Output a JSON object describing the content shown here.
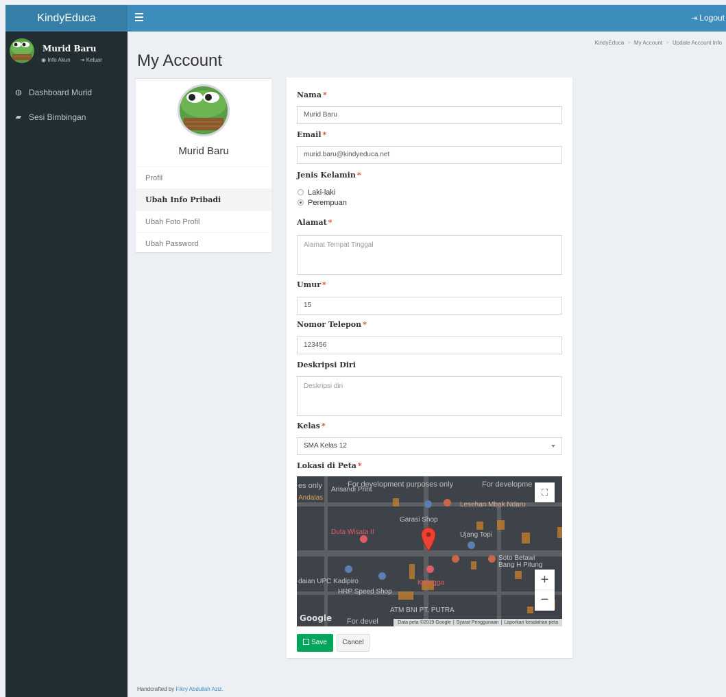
{
  "app": {
    "brand": "KindyEduca",
    "logout_label": "Logout"
  },
  "user": {
    "name": "Murid Baru",
    "info_link": "Info Akun",
    "logout_link": "Keluar"
  },
  "sidebar": {
    "items": [
      {
        "label": "Dashboard Murid",
        "icon": "dashboard-icon"
      },
      {
        "label": "Sesi Bimbingan",
        "icon": "book-icon"
      }
    ]
  },
  "page": {
    "title": "My Account"
  },
  "breadcrumb": [
    "KindyEduca",
    "My Account",
    "Update Account Info"
  ],
  "profile": {
    "name": "Murid Baru",
    "menu": [
      "Profil",
      "Ubah Info Pribadi",
      "Ubah Foto Profil",
      "Ubah Password"
    ],
    "active_index": 1
  },
  "form": {
    "nama": {
      "label": "Nama",
      "value": "Murid Baru"
    },
    "email": {
      "label": "Email",
      "value": "murid.baru@kindyeduca.net"
    },
    "gender": {
      "label": "Jenis Kelamin",
      "options": [
        "Laki-laki",
        "Perempuan"
      ],
      "selected": "Perempuan"
    },
    "alamat": {
      "label": "Alamat",
      "placeholder": "Alamat Tempat Tinggal"
    },
    "umur": {
      "label": "Umur",
      "value": "15"
    },
    "telepon": {
      "label": "Nomor Telepon",
      "value": "123456"
    },
    "deskripsi": {
      "label": "Deskripsi Diri",
      "placeholder": "Deskripsi diri"
    },
    "kelas": {
      "label": "Kelas",
      "value": "SMA Kelas 12"
    },
    "lokasi": {
      "label": "Lokasi di Peta"
    },
    "save_label": "Save",
    "cancel_label": "Cancel"
  },
  "map": {
    "dev_notice": [
      "es only",
      "For development purposes only",
      "For developme",
      "For devel"
    ],
    "places": [
      "Andalas",
      "Arisandi Print",
      "Lesehan Mbak Ndaru",
      "Garasi Shop",
      "Duta Wisata II",
      "Ujang Topi",
      "Soto Betawi",
      "Bang H Pitung",
      "daian UPC Kadipiro",
      "Kalingga",
      "HRP Speed Shop",
      "ATM BNI PT. PUTRA"
    ],
    "attribution": [
      "Data peta ©2019 Google",
      "Syarat Penggunaan",
      "Laporkan kesalahan peta"
    ],
    "logo": "Google",
    "zoom_in": "+",
    "zoom_out": "−"
  },
  "footer": {
    "prefix": "Handcrafted by ",
    "author": "Fikry Abdullah Aziz",
    "suffix": "."
  }
}
